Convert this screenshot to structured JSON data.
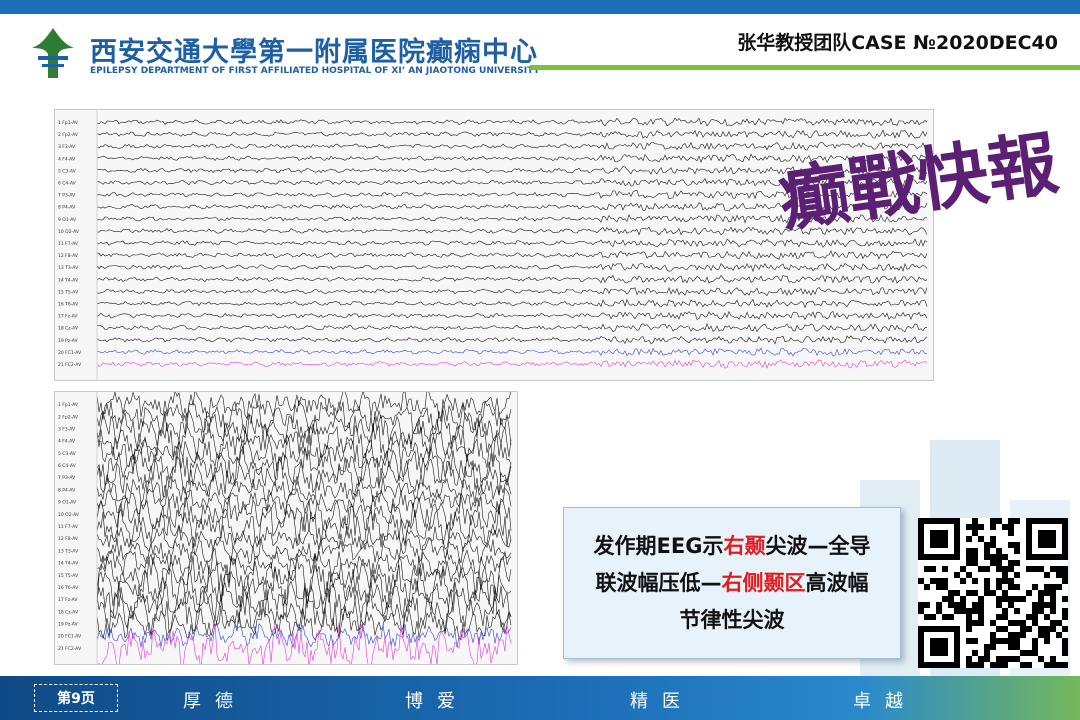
{
  "header": {
    "title_cn": "西安交通大學第一附属医院癫痫中心",
    "title_en": "EPILEPSY DEPARTMENT OF FIRST AFFILIATED HOSPITAL OF XI’ AN JIAOTONG UNIVERSITY",
    "case_label": "张华教授团队CASE №2020DEC40"
  },
  "calligraphy_text": "癫戰快報",
  "eeg": {
    "channel_labels": [
      "Fp1-AV",
      "Fp2-AV",
      "F3-AV",
      "F4-AV",
      "C3-AV",
      "C4-AV",
      "P3-AV",
      "P4-AV",
      "O1-AV",
      "O2-AV",
      "F7-AV",
      "F8-AV",
      "T3-AV",
      "T4-AV",
      "T5-AV",
      "T6-AV",
      "Fz-AV",
      "Cz-AV",
      "Pz-AV",
      "FC1-AV",
      "FC2-AV"
    ],
    "colors": {
      "trace": "#1a1a1a",
      "blue": "#3b48d6",
      "magenta": "#e23fd8",
      "grid": "#d0d0d0"
    }
  },
  "caption": {
    "line1_a": "发作期EEG示",
    "line1_b": "右颞",
    "line1_c": "尖波—全导",
    "line2_a": "联波幅压低—",
    "line2_b": "右侧颞区",
    "line2_c": "高波幅",
    "line3": "节律性尖波",
    "highlight_color": "#e21c1c"
  },
  "footer": {
    "page_label": "第9页",
    "words": [
      "厚德",
      "博爱",
      "精医",
      "卓越"
    ]
  }
}
